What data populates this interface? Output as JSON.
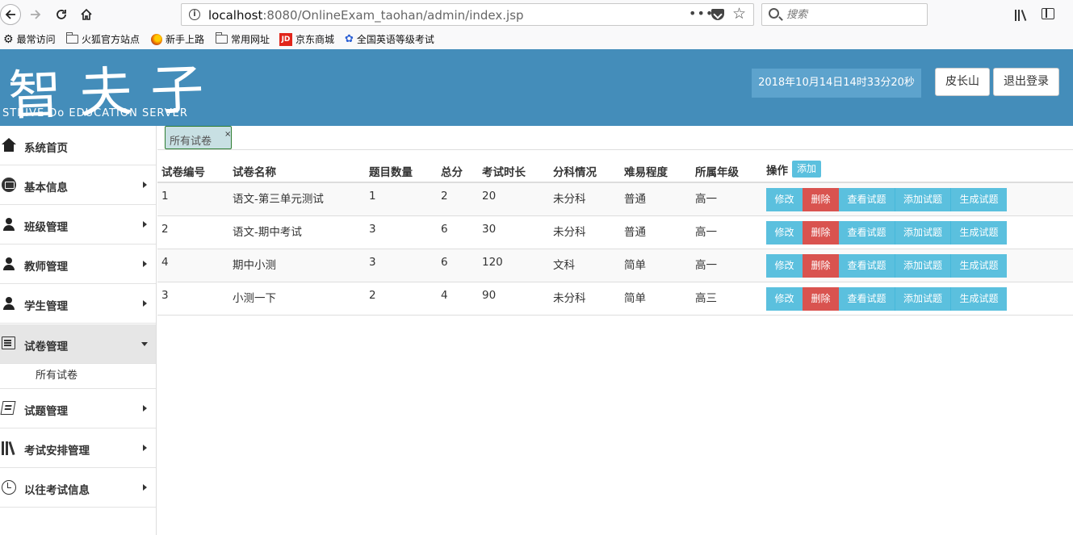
{
  "browser": {
    "url_host": "localhost",
    "url_path": ":8080/OnlineExam_taohan/admin/index.jsp",
    "url_more": "•••",
    "search_placeholder": "搜索",
    "bookmarks": [
      {
        "label": "最常访问",
        "icon": "gear-icon"
      },
      {
        "label": "火狐官方站点",
        "icon": "folder-icon"
      },
      {
        "label": "新手上路",
        "icon": "firefox-icon"
      },
      {
        "label": "常用网址",
        "icon": "folder-icon"
      },
      {
        "label": "京东商城",
        "icon": "jd-icon",
        "icon_text": "JD"
      },
      {
        "label": "全国英语等级考试",
        "icon": "paw-icon"
      }
    ]
  },
  "header": {
    "logo_title": "智夫子",
    "logo_subtitle": "STRIVE Do EDUCATION SERVER",
    "clock": "2018年10月14日14时33分20秒",
    "user_label": "皮长山",
    "logout_label": "退出登录",
    "bg_color": "#448dba"
  },
  "sidebar": {
    "items": [
      {
        "label": "系统首页",
        "icon": "home-icon",
        "has_arrow": false
      },
      {
        "label": "基本信息",
        "icon": "info-card-icon",
        "has_arrow": true
      },
      {
        "label": "班级管理",
        "icon": "user-icon",
        "has_arrow": true
      },
      {
        "label": "教师管理",
        "icon": "user-icon",
        "has_arrow": true
      },
      {
        "label": "学生管理",
        "icon": "user-icon",
        "has_arrow": true
      },
      {
        "label": "试卷管理",
        "icon": "document-icon",
        "has_arrow": true,
        "expanded": true
      },
      {
        "label": "试题管理",
        "icon": "book-icon",
        "has_arrow": true
      },
      {
        "label": "考试安排管理",
        "icon": "books-icon",
        "has_arrow": true
      },
      {
        "label": "以往考试信息",
        "icon": "clock-icon",
        "has_arrow": true
      }
    ],
    "sub_items": [
      {
        "label": "所有试卷"
      }
    ]
  },
  "tabs": [
    {
      "label": "所有试卷",
      "close": "×"
    }
  ],
  "table": {
    "headers": [
      "试卷编号",
      "试卷名称",
      "题目数量",
      "总分",
      "考试时长",
      "分科情况",
      "难易程度",
      "所属年级",
      "操作"
    ],
    "add_label": "添加",
    "actions": [
      "修改",
      "删除",
      "查看试题",
      "添加试题",
      "生成试题"
    ],
    "rows": [
      [
        "1",
        "语文-第三单元测试",
        "1",
        "2",
        "20",
        "未分科",
        "普通",
        "高一"
      ],
      [
        "2",
        "语文-期中考试",
        "3",
        "6",
        "30",
        "未分科",
        "普通",
        "高一"
      ],
      [
        "4",
        "期中小测",
        "3",
        "6",
        "120",
        "文科",
        "简单",
        "高一"
      ],
      [
        "3",
        "小测一下",
        "2",
        "4",
        "90",
        "未分科",
        "简单",
        "高三"
      ]
    ]
  },
  "colors": {
    "info": "#5bc0de",
    "danger": "#d9534f",
    "tab_bg": "#c8e0e3"
  }
}
